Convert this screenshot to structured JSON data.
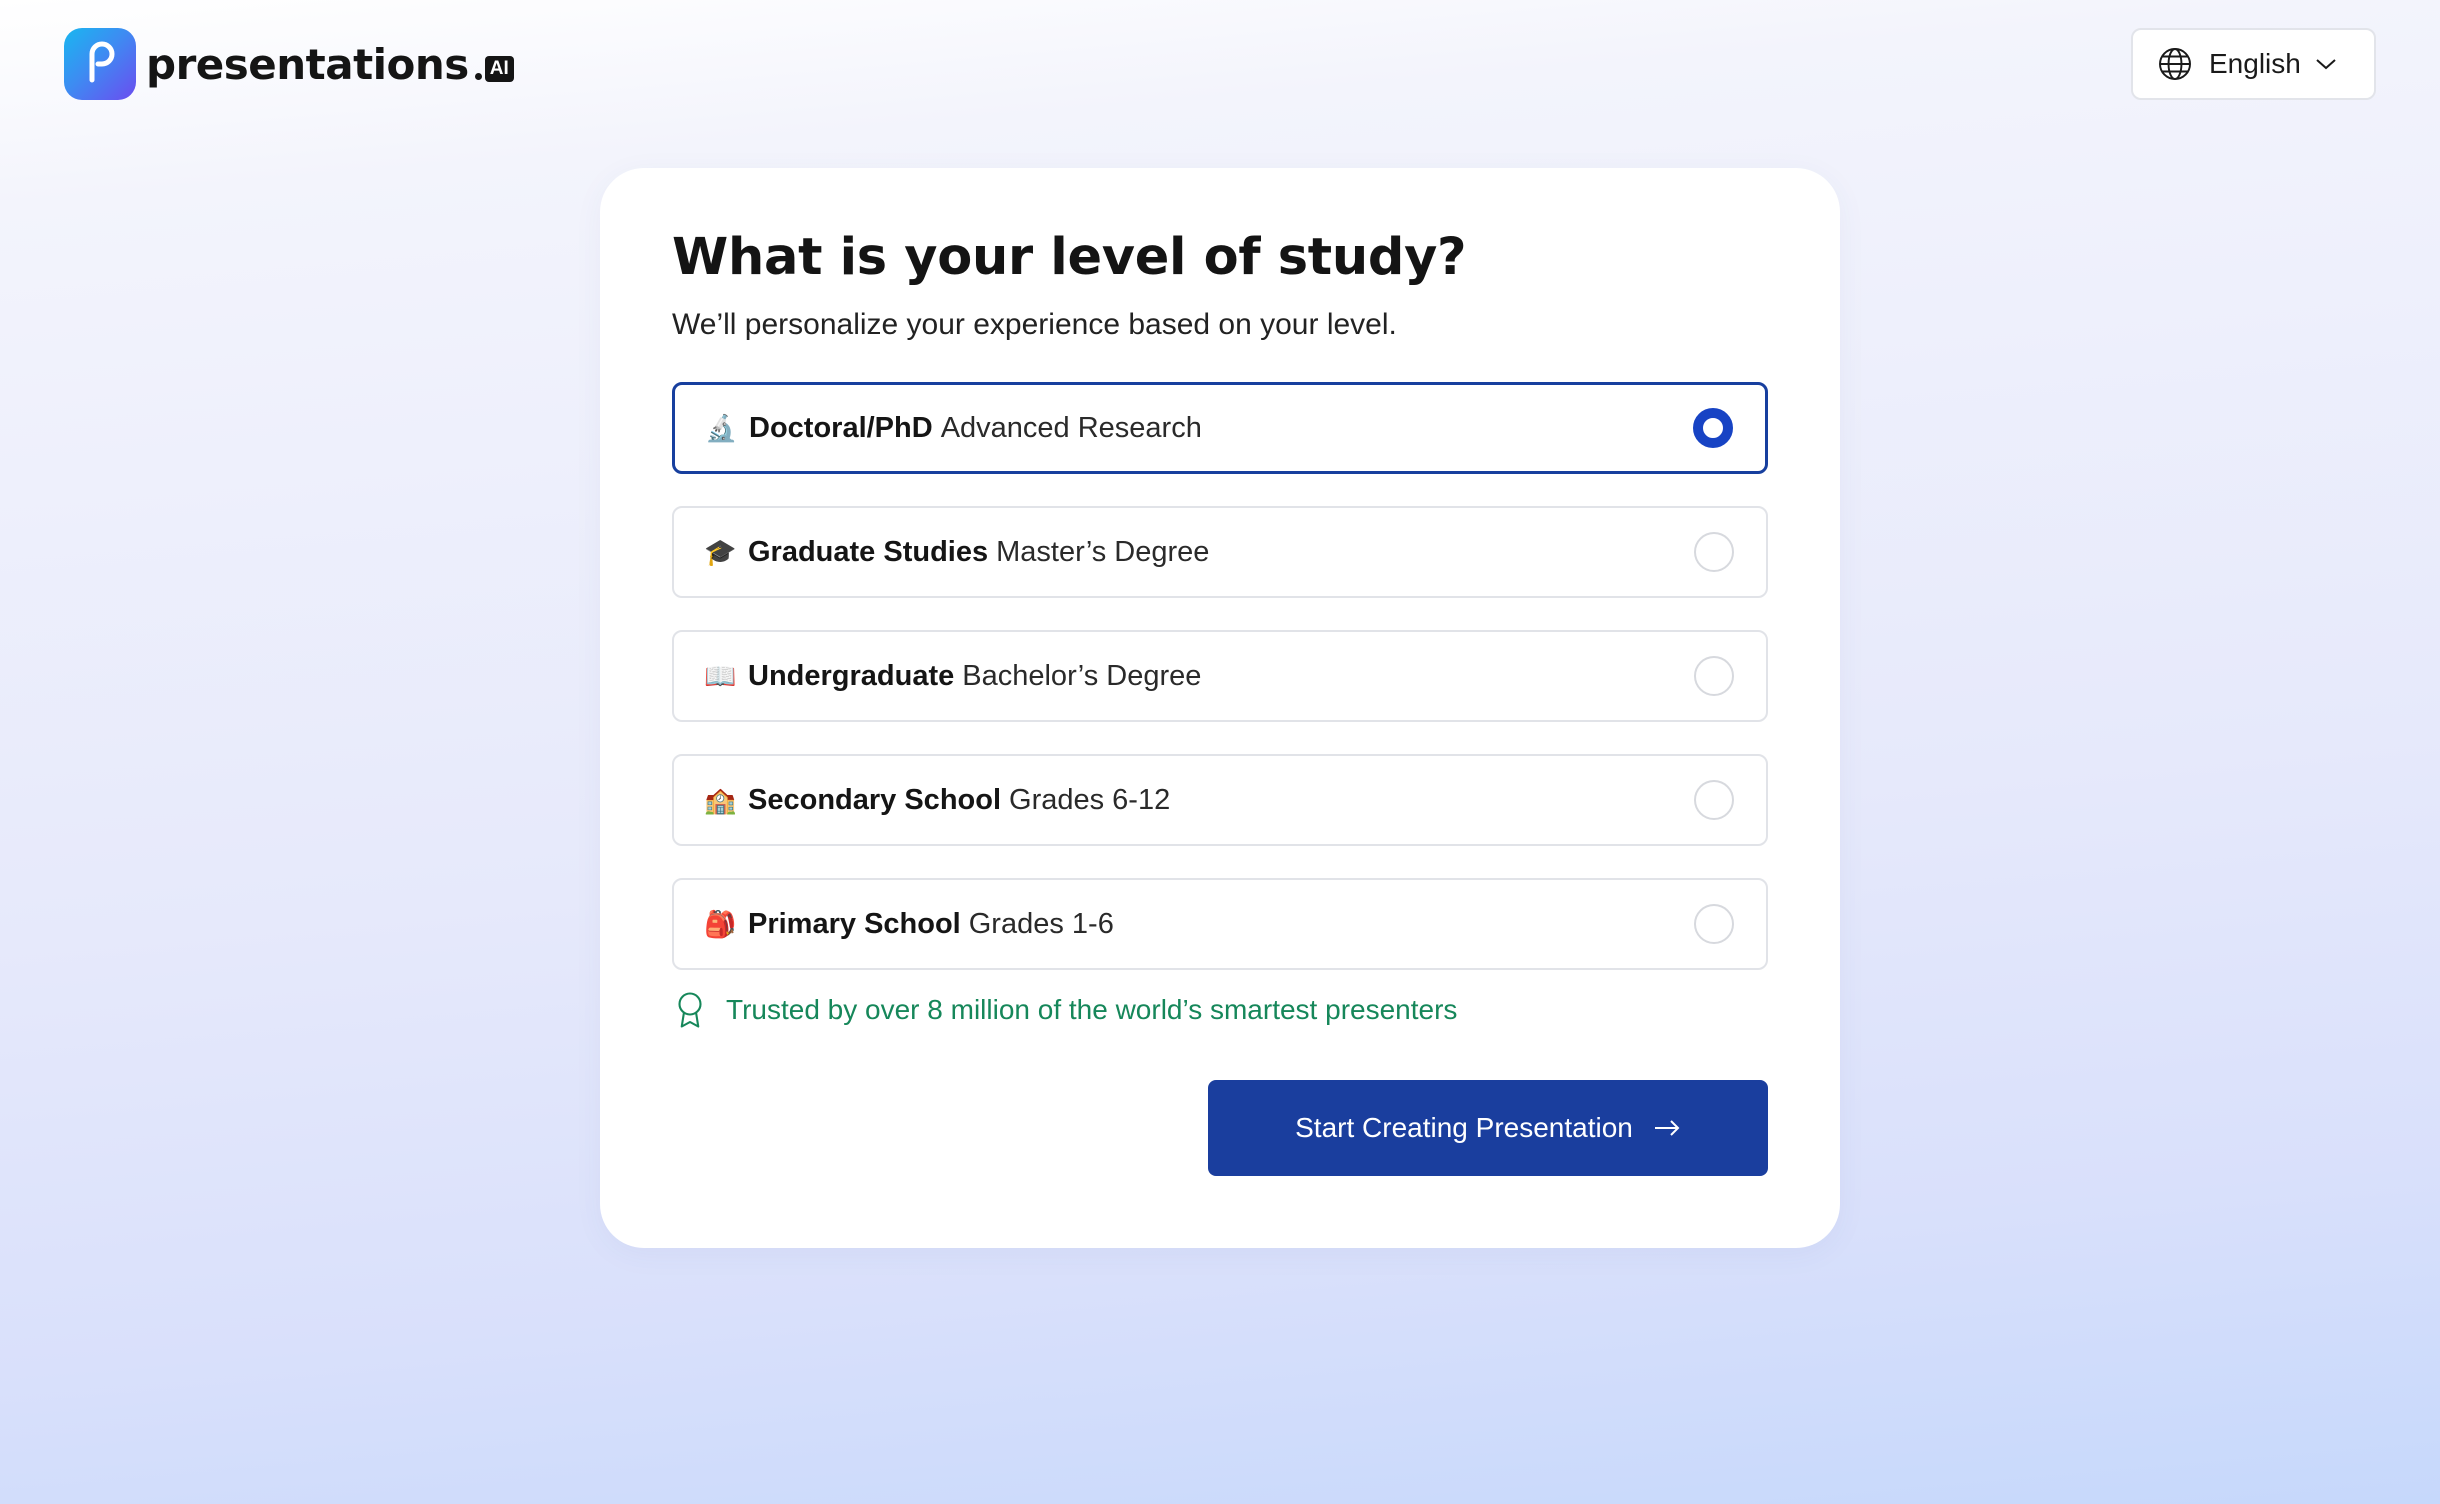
{
  "brand": {
    "name": "presentations",
    "suffix": "AI",
    "gradient": [
      "#19b7f0",
      "#6b4cf0"
    ]
  },
  "language": {
    "selected": "English",
    "icon": "globe-icon"
  },
  "card": {
    "title": "What is your level of study?",
    "subtitle": "We’ll personalize your experience based on your level.",
    "options": [
      {
        "icon": "🔬",
        "title": "Doctoral/PhD",
        "desc": "Advanced Research",
        "selected": true
      },
      {
        "icon": "🎓",
        "title": "Graduate Studies",
        "desc": "Master’s Degree",
        "selected": false
      },
      {
        "icon": "📖",
        "title": "Undergraduate",
        "desc": "Bachelor’s Degree",
        "selected": false
      },
      {
        "icon": "🏫",
        "title": "Secondary School",
        "desc": "Grades 6-12",
        "selected": false
      },
      {
        "icon": "🎒",
        "title": "Primary School",
        "desc": "Grades 1-6",
        "selected": false
      }
    ],
    "trust_text": "Trusted by over 8 million of the world’s smartest presenters",
    "cta_label": "Start Creating Presentation"
  },
  "colors": {
    "primary": "#1a3e9e",
    "radio_selected": "#1743c4",
    "trust_green": "#16875a"
  }
}
